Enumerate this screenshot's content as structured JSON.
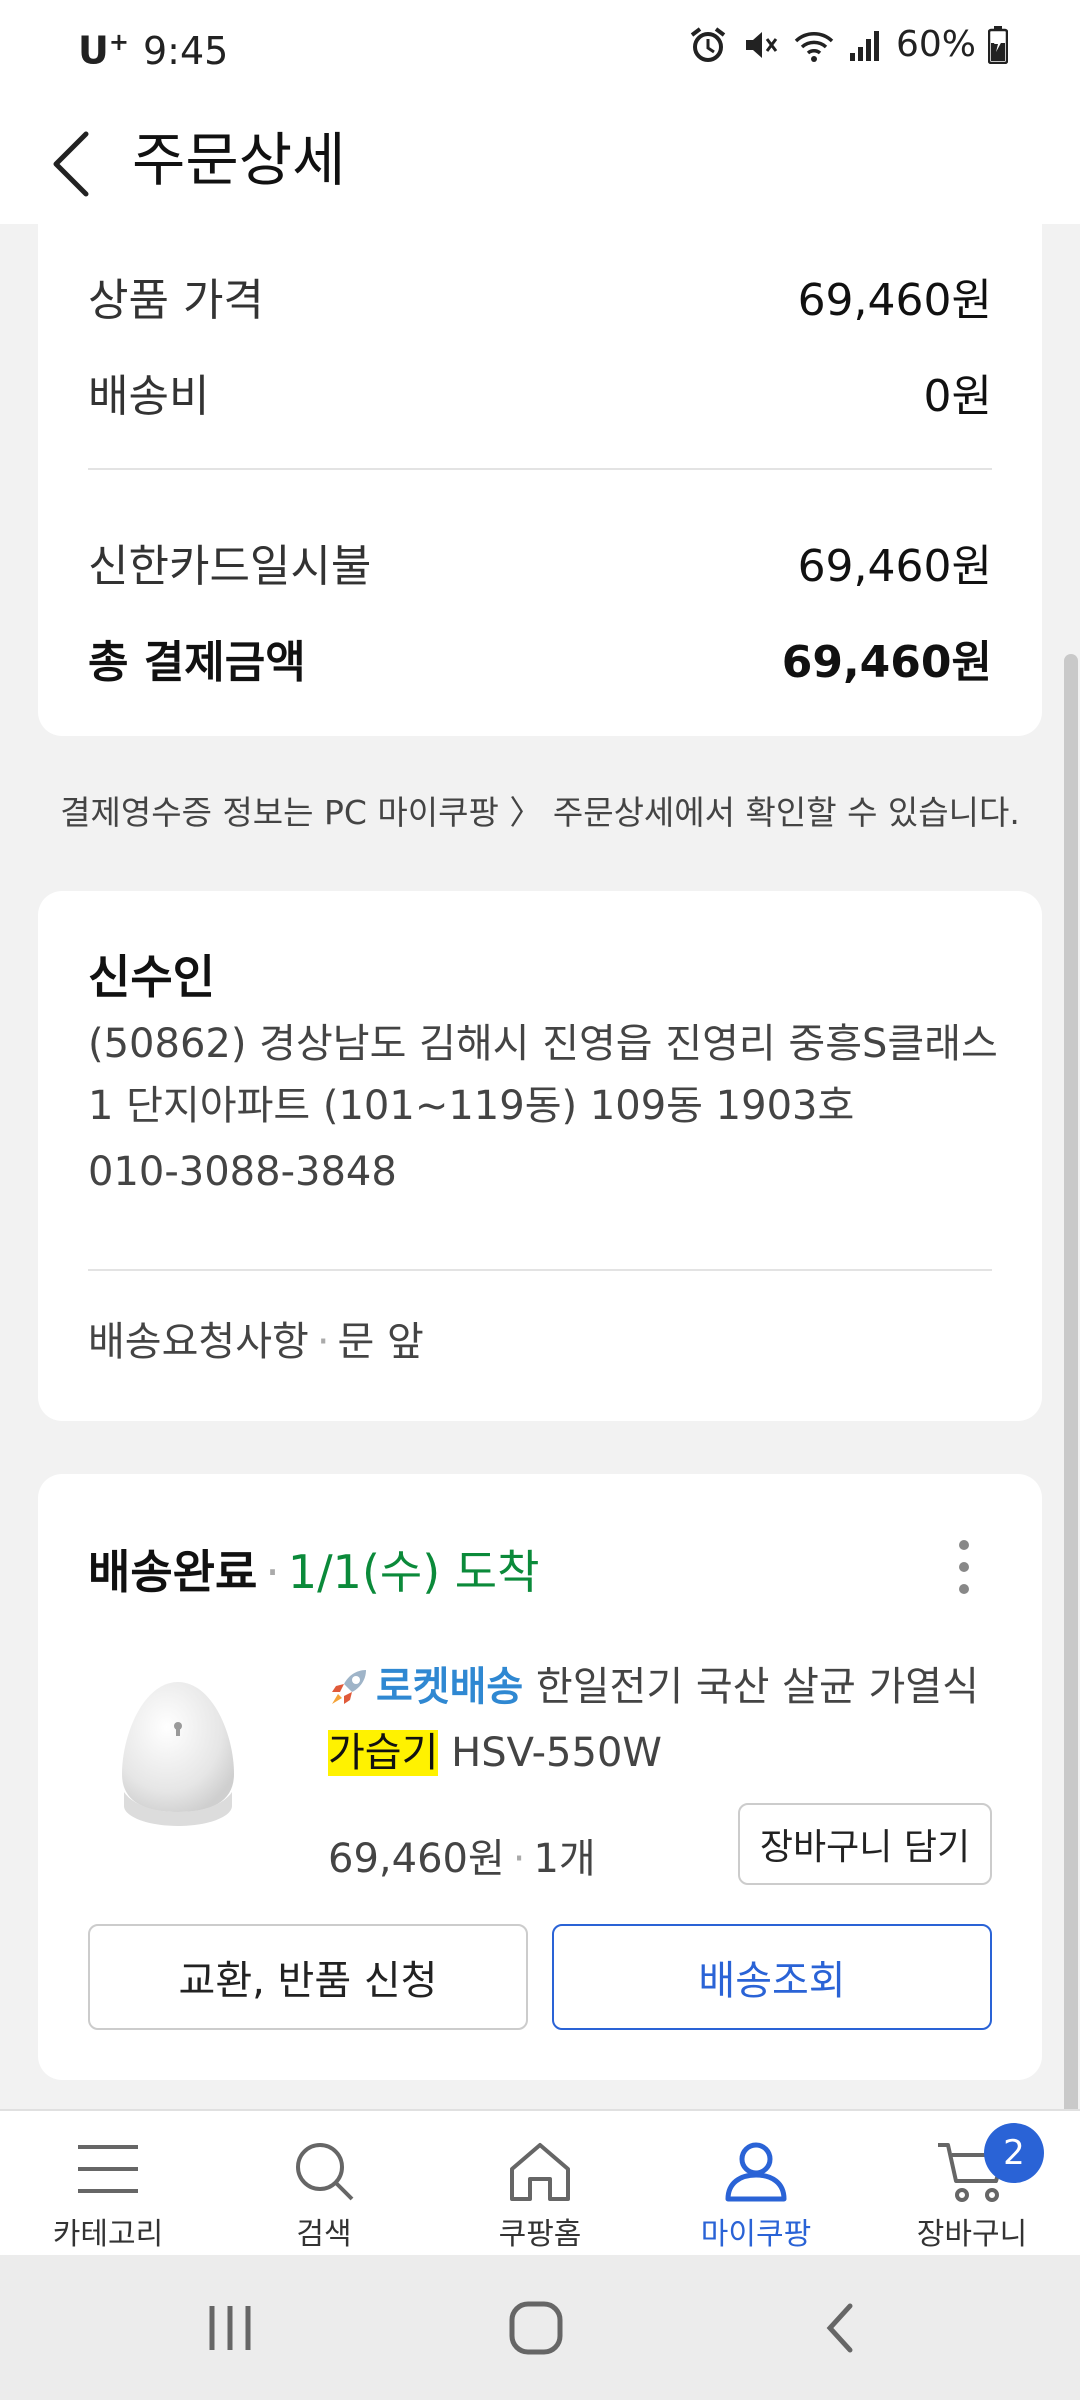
{
  "status_bar": {
    "carrier": "U",
    "carrier_sup": "+",
    "time": "9:45",
    "battery": "60%"
  },
  "header": {
    "title": "주문상세"
  },
  "summary": {
    "product_price_label": "상품 가격",
    "product_price": "69,460원",
    "shipping_label": "배송비",
    "shipping": "0원",
    "payment_method_label": "신한카드일시불",
    "payment_amount": "69,460원",
    "total_label": "총 결제금액",
    "total": "69,460원"
  },
  "receipt_note": "결제영수증 정보는 PC 마이쿠팡 〉 주문상세에서 확인할 수 있습니다.",
  "recipient": {
    "title": "신수인",
    "address": "(50862) 경상남도 김해시 진영읍 진영리 중흥S클래스1 단지아파트 (101~119동) 109동 1903호",
    "phone": "010-3088-3848",
    "request_label": "배송요청사항",
    "request_value": "문 앞"
  },
  "delivery": {
    "status": "배송완료",
    "arrival": "1/1(수) 도착",
    "product": {
      "badge": "로켓배송",
      "name_before": "한일전기 국산 살균 가열식",
      "name_highlight": "가습기",
      "name_after": "HSV-550W",
      "price": "69,460원",
      "quantity": "1개"
    },
    "cart_button": "장바구니 담기",
    "exchange_button": "교환, 반품 신청",
    "track_button": "배송조회"
  },
  "bottom_nav": {
    "items": [
      {
        "label": "카테고리",
        "icon": "menu-icon"
      },
      {
        "label": "검색",
        "icon": "search-icon"
      },
      {
        "label": "쿠팡홈",
        "icon": "home-icon"
      },
      {
        "label": "마이쿠팡",
        "icon": "user-icon"
      },
      {
        "label": "장바구니",
        "icon": "cart-icon"
      }
    ],
    "active": "마이쿠팡",
    "cart_badge": "2"
  },
  "colors": {
    "accent": "#2a63d6",
    "success": "#0b8a3a",
    "rocket": "#2f88d2",
    "highlight": "#fff200"
  }
}
